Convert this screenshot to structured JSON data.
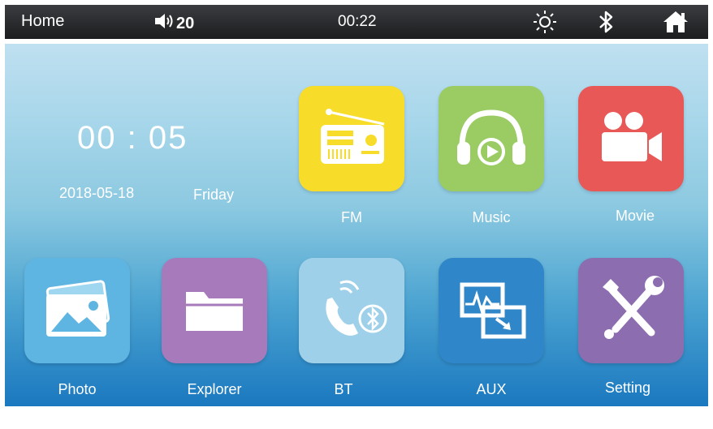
{
  "status_bar": {
    "home_label": "Home",
    "volume_icon": "speaker-icon",
    "volume_value": "20",
    "time": "00:22",
    "icons": [
      "brightness-icon",
      "bluetooth-icon",
      "home-icon"
    ]
  },
  "clock_widget": {
    "time": "00 : 05",
    "date": "2018-05-18",
    "weekday": "Friday"
  },
  "apps": [
    {
      "label": "FM",
      "icon": "radio-icon",
      "color": "#f7dd2a"
    },
    {
      "label": "Music",
      "icon": "headphones-icon",
      "color": "#9bcb63"
    },
    {
      "label": "Movie",
      "icon": "video-camera-icon",
      "color": "#e85857"
    },
    {
      "label": "Photo",
      "icon": "photo-icon",
      "color": "#5fb5e2"
    },
    {
      "label": "Explorer",
      "icon": "folder-icon",
      "color": "#a77bbb"
    },
    {
      "label": "BT",
      "icon": "bluetooth-phone-icon",
      "color": "#9fd0ea"
    },
    {
      "label": "AUX",
      "icon": "aux-input-icon",
      "color": "#2f86c8"
    },
    {
      "label": "Setting",
      "icon": "wrench-screwdriver-icon",
      "color": "#8b6db0"
    }
  ]
}
